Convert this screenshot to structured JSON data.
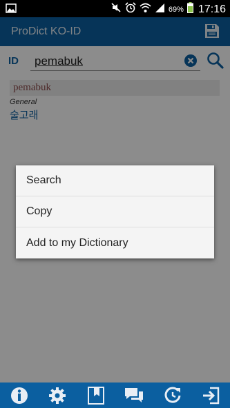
{
  "status_bar": {
    "battery_percent": "69%",
    "time": "17:16"
  },
  "app_bar": {
    "title": "ProDict KO-ID"
  },
  "search": {
    "lang_label": "ID",
    "query": "pemabuk"
  },
  "result": {
    "word": "pemabuk",
    "category": "General",
    "translation": "술고래"
  },
  "context_menu": {
    "items": [
      {
        "label": "Search"
      },
      {
        "label": "Copy"
      },
      {
        "label": "Add to my Dictionary"
      }
    ]
  },
  "bottom_bar": {
    "icons": [
      "info-icon",
      "settings-gear-icon",
      "bookmark-icon",
      "chat-icon",
      "history-icon",
      "exit-icon"
    ]
  },
  "colors": {
    "accent": "#0b5fa0",
    "status_bar": "#000000",
    "result_word": "#8a4a4a"
  }
}
